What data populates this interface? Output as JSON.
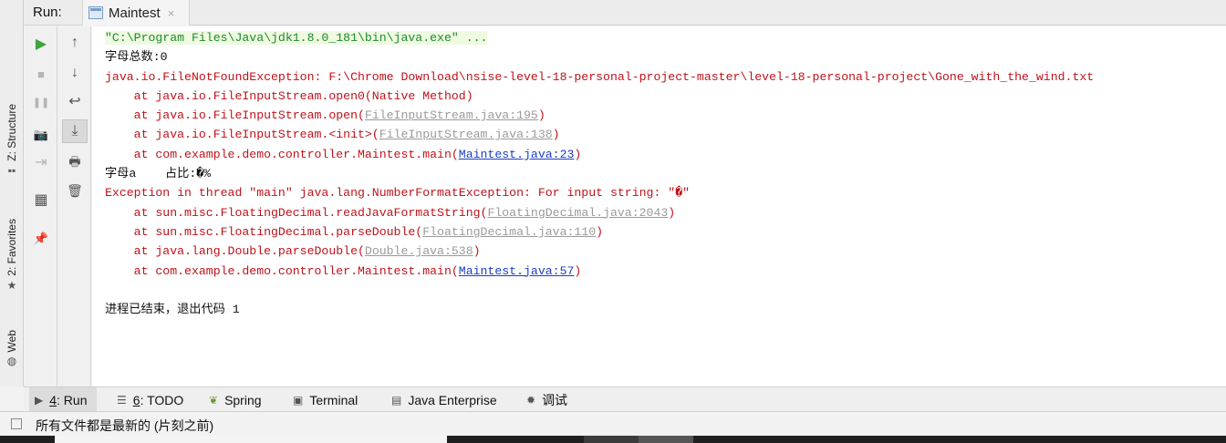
{
  "run_header": {
    "label": "Run:",
    "tab_label": "Maintest",
    "tab_close": "×"
  },
  "side_tabs": [
    {
      "label": "Z: Structure",
      "icon": "structure-icon"
    },
    {
      "label": "2: Favorites",
      "icon": "star-icon"
    },
    {
      "label": "Web",
      "icon": "globe-icon"
    }
  ],
  "toolbar_left": [
    {
      "name": "rerun-button",
      "icon": "▶",
      "state": "green"
    },
    {
      "name": "stop-button",
      "icon": "■",
      "state": "gray"
    },
    {
      "name": "pause-button",
      "icon": "❚❚",
      "state": "gray"
    },
    {
      "name": "dump-threads-button",
      "icon": "📷",
      "state": "gray"
    },
    {
      "name": "exit-button",
      "icon": "⇥",
      "state": "gray"
    },
    {
      "name": "layout-button",
      "icon": "▦",
      "state": "normal"
    },
    {
      "name": "pin-button",
      "icon": "📌",
      "state": "normal"
    }
  ],
  "toolbar_right": [
    {
      "name": "up-button",
      "icon": "↑"
    },
    {
      "name": "down-button",
      "icon": "↓"
    },
    {
      "name": "soft-wrap-button",
      "icon": "↩"
    },
    {
      "name": "scroll-to-end-button",
      "icon": "⤓",
      "active": true
    },
    {
      "name": "print-button",
      "icon": "🖶"
    },
    {
      "name": "clear-button",
      "icon": "🗑"
    }
  ],
  "console": {
    "cmd": "\"C:\\Program Files\\Java\\jdk1.8.0_181\\bin\\java.exe\" ...",
    "line_total": "字母总数:0",
    "fnf_exception": "java.io.FileNotFoundException: F:\\Chrome Download\\nsise-level-18-personal-project-master\\level-18-personal-project\\Gone_with_the_wind.txt",
    "fnf_frame1": "    at java.io.FileInputStream.open0(Native Method)",
    "fnf_frame2_pre": "    at java.io.FileInputStream.open(",
    "fnf_frame2_link": "FileInputStream.java:195",
    "fnf_frame3_pre": "    at java.io.FileInputStream.<init>(",
    "fnf_frame3_link": "FileInputStream.java:138",
    "fnf_frame4_pre": "    at com.example.demo.controller.Maintest.main(",
    "fnf_frame4_link": "Maintest.java:23",
    "line_ratio": "字母a    占比:�%",
    "nfe_exception": "Exception in thread \"main\" java.lang.NumberFormatException: For input string: \"�\"",
    "nfe_frame1_pre": "    at sun.misc.FloatingDecimal.readJavaFormatString(",
    "nfe_frame1_link": "FloatingDecimal.java:2043",
    "nfe_frame2_pre": "    at sun.misc.FloatingDecimal.parseDouble(",
    "nfe_frame2_link": "FloatingDecimal.java:110",
    "nfe_frame3_pre": "    at java.lang.Double.parseDouble(",
    "nfe_frame3_link": "Double.java:538",
    "nfe_frame4_pre": "    at com.example.demo.controller.Maintest.main(",
    "nfe_frame4_link": "Maintest.java:57",
    "close_paren": ")",
    "exit_line": "进程已结束，退出代码 1"
  },
  "bottom_tabs": [
    {
      "key": "4",
      "label": ": Run",
      "icon": "▶",
      "active": true
    },
    {
      "key": "6",
      "label": ": TODO",
      "icon": "☰"
    },
    {
      "key": "",
      "label": "Spring",
      "icon": "❦"
    },
    {
      "key": "",
      "label": "Terminal",
      "icon": "▣"
    },
    {
      "key": "",
      "label": "Java Enterprise",
      "icon": "▤"
    },
    {
      "key": "",
      "label": "调试",
      "icon": "✹"
    }
  ],
  "status": {
    "text": "所有文件都是最新的 (片刻之前)"
  },
  "colors": {
    "command": "#1e8a2e",
    "error": "#c0121a",
    "link": "#1a3cc7",
    "library_link": "#9a9a9a"
  }
}
